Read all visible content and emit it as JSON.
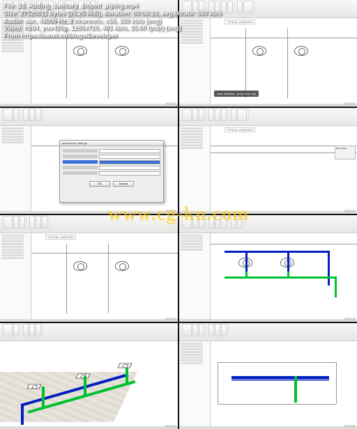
{
  "meta": {
    "file_label": "File:",
    "file_value": "28. Adding_sanitary_sloped_piping.mp4",
    "size_label": "Size:",
    "size_value": "27520011 bytes (26.25 MiB), duration: 00:06:28, avg.bitrate: 560 kb/s",
    "audio_label": "Audio:",
    "audio_value": "aac, 48000 Hz, 2 channels, s16, 160 kb/s (eng)",
    "video_label": "Video:",
    "video_value": "h264, yuv420p, 1280x720, 401 kb/s, 15.00 fps(r) (eng)",
    "from_label": "From",
    "from_value": "https://sanet.cd/blogs/Developer"
  },
  "watermark": "www.cg-ku.com",
  "canvas_label": "TYPICAL LAVATORY",
  "tooltip": {
    "clear": "clear selection",
    "esc": "press \"esc\" key"
  },
  "dialog": {
    "title": "Mechanical Settings",
    "btn_ok": "OK",
    "btn_cancel": "Cancel"
  },
  "props_title": "Pipe Types",
  "timestamp": {
    "t1": "00:00:11",
    "t2": "00:00:31",
    "t3": "00:00:51",
    "t4": "00:01:01",
    "t5": "00:01:11",
    "t6": "00:01:31",
    "t7": "00:01:51",
    "t8": "00:02:01"
  },
  "chart_data": {
    "type": "table",
    "description": "4x2 grid of video thumbnails from a Revit screencast",
    "thumbnails": [
      {
        "pos": "r1c1",
        "scene": "plan view, two toilet fixtures, tree panel left"
      },
      {
        "pos": "r1c2",
        "scene": "same plan view, dark tooltip 'clear selection / press esc key'"
      },
      {
        "pos": "r2c1",
        "scene": "Mechanical Settings dialog open over plan"
      },
      {
        "pos": "r2c2",
        "scene": "plan view with properties palette on right"
      },
      {
        "pos": "r3c1",
        "scene": "plan view, fixtures, tree"
      },
      {
        "pos": "r3c2",
        "scene": "plan view with blue and green piping routed between fixtures"
      },
      {
        "pos": "r4c1",
        "scene": "3D isometric view, tiled floor, blue+green pipe runs, fixtures"
      },
      {
        "pos": "r4c2",
        "scene": "elevation/section, blue horizontal pipe with green drop"
      }
    ]
  }
}
